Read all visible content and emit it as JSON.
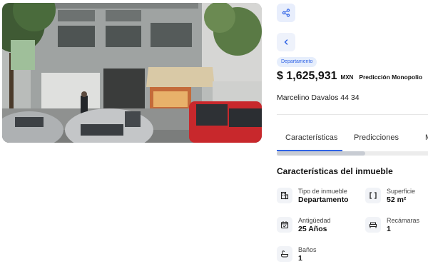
{
  "property": {
    "type_chip": "Departamento",
    "price": "$ 1,625,931",
    "currency": "MXN",
    "prediction_label": "Predicción Monopolio",
    "address": "Marcelino Davalos 44 34"
  },
  "tabs": [
    {
      "label": "Características"
    },
    {
      "label": "Predicciones"
    },
    {
      "label": "M"
    }
  ],
  "section": {
    "title": "Características del inmueble"
  },
  "features": [
    {
      "label": "Tipo de inmueble",
      "value": "Departamento",
      "icon": "building-icon"
    },
    {
      "label": "Superficie",
      "value": "52 m²",
      "icon": "surface-brackets-icon"
    },
    {
      "label": "Antigüedad",
      "value": "25 Años",
      "icon": "calendar-icon"
    },
    {
      "label": "Recámaras",
      "value": "1",
      "icon": "bed-icon"
    },
    {
      "label": "Baños",
      "value": "1",
      "icon": "bathtub-icon"
    }
  ],
  "colors": {
    "accent": "#2f63e6",
    "chip_bg": "#e6eefc"
  }
}
